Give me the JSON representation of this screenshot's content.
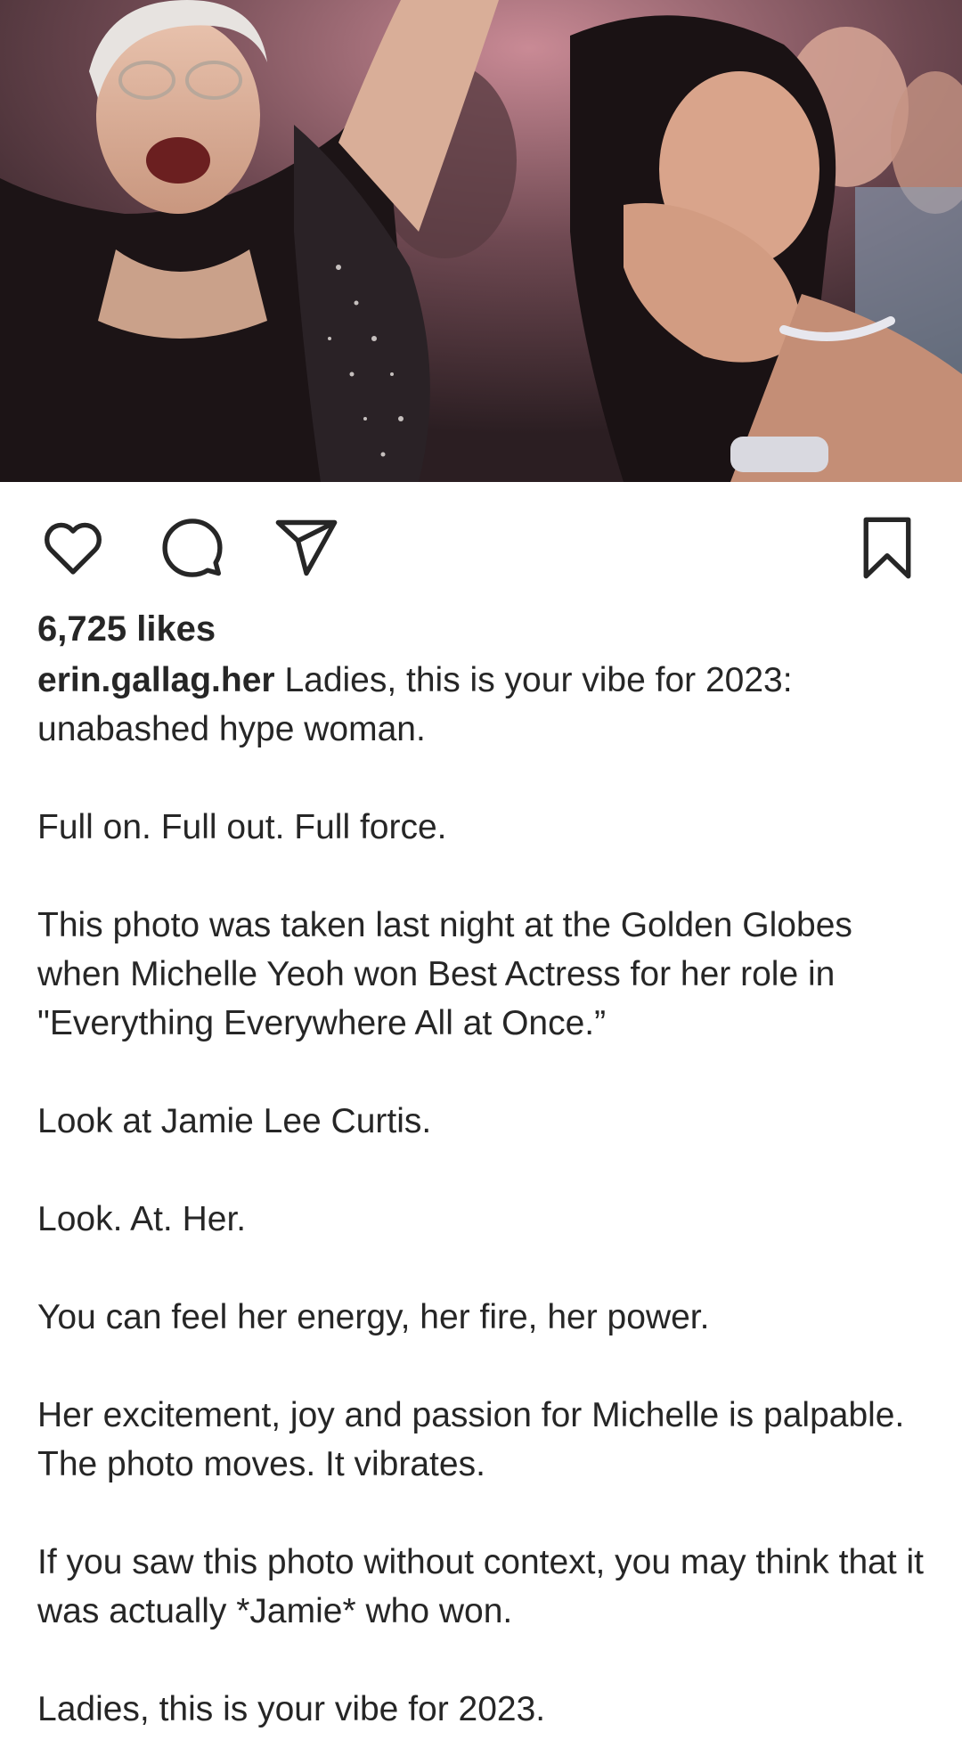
{
  "post": {
    "image_description": "",
    "actions": {
      "like_icon": "heart-outline-icon",
      "comment_icon": "comment-bubble-icon",
      "share_icon": "paper-plane-icon",
      "save_icon": "bookmark-outline-icon"
    },
    "likes": "6,725 likes",
    "username": "erin.gallag.her",
    "caption_first": "Ladies, this is your vibe for 2023: unabashed hype woman.",
    "caption_paragraphs": [
      "Full on. Full out. Full force.",
      "This photo was taken last night at the Golden Globes when Michelle Yeoh won Best Actress for her role in \"Everything Everywhere All at Once.”",
      "Look at Jamie Lee Curtis.",
      "Look. At. Her.",
      "You can feel her energy, her fire, her power.",
      "Her excitement, joy and passion for Michelle is palpable. The photo moves. It vibrates.",
      "If you saw this photo without context, you may think that it was actually *Jamie* who won.",
      "Ladies, this is your vibe for 2023."
    ]
  },
  "colors": {
    "text": "#262626",
    "background": "#ffffff",
    "icon": "#262626"
  }
}
